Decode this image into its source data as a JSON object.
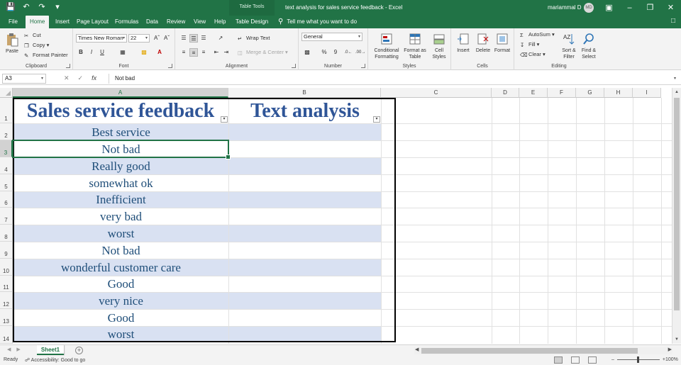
{
  "window": {
    "title": "text analysis for sales service feedback  -  Excel",
    "context_tab": "Table Tools",
    "user": "mariammal D",
    "user_initials": "MD"
  },
  "tabs": [
    "File",
    "Home",
    "Insert",
    "Page Layout",
    "Formulas",
    "Data",
    "Review",
    "View",
    "Help",
    "Table Design"
  ],
  "active_tab": "Home",
  "tell_me": "Tell me what you want to do",
  "ribbon": {
    "clipboard": {
      "label": "Clipboard",
      "paste": "Paste",
      "cut": "Cut",
      "copy": "Copy",
      "format_painter": "Format Painter"
    },
    "font": {
      "label": "Font",
      "font_name": "Times New Roman",
      "font_size": "22",
      "bold": "B",
      "italic": "I",
      "underline": "U"
    },
    "alignment": {
      "label": "Alignment",
      "wrap_text": "Wrap Text",
      "merge_center": "Merge & Center"
    },
    "number": {
      "label": "Number",
      "format": "General",
      "percent": "%",
      "comma": "9"
    },
    "styles": {
      "label": "Styles",
      "conditional": "Conditional Formatting",
      "format_table": "Format as Table",
      "cell_styles": "Cell Styles"
    },
    "cells": {
      "label": "Cells",
      "insert": "Insert",
      "delete": "Delete",
      "format": "Format"
    },
    "editing": {
      "label": "Editing",
      "autosum": "AutoSum",
      "fill": "Fill",
      "clear": "Clear",
      "sort_filter": "Sort & Filter",
      "find_select": "Find & Select"
    }
  },
  "formula_bar": {
    "name_box": "A3",
    "content": "Not bad",
    "fx": "fx"
  },
  "columns": [
    "A",
    "B",
    "C",
    "D",
    "E",
    "F",
    "G",
    "H",
    "I"
  ],
  "rows": [
    "1",
    "2",
    "3",
    "4",
    "5",
    "6",
    "7",
    "8",
    "9",
    "10",
    "11",
    "12",
    "13",
    "14"
  ],
  "table": {
    "headers": [
      "Sales service feedback",
      "Text analysis"
    ],
    "feedback": [
      "Best service",
      "Not bad",
      "Really good",
      "somewhat ok",
      "Inefficient",
      "very bad",
      "worst",
      "Not bad",
      "wonderful customer care",
      "Good",
      "very nice",
      "Good",
      "worst"
    ]
  },
  "sheet": {
    "tab": "Sheet1"
  },
  "status": {
    "ready": "Ready",
    "accessibility": "Accessibility: Good to go",
    "zoom": "100%"
  },
  "colors": {
    "excel_green": "#217346",
    "band": "#d9e1f2",
    "header_text": "#2f5597",
    "cell_text": "#1f4e79"
  }
}
